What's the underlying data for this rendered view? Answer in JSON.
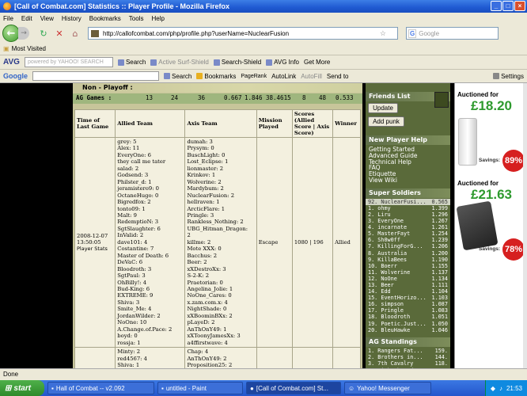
{
  "window": {
    "title": "[Call of Combat.com] Statistics :: Player Profile - Mozilla Firefox"
  },
  "menu": [
    "File",
    "Edit",
    "View",
    "History",
    "Bookmarks",
    "Tools",
    "Help"
  ],
  "nav": {
    "url": "http://callofcombat.com/php/profile.php?userName=NuclearFusion",
    "search_placeholder": "Google"
  },
  "bookmarks": {
    "item": "Most Visited"
  },
  "avgbar": {
    "logo": "AVG",
    "yahoo_placeholder": "powered by YAHOO! SEARCH",
    "search": "Search",
    "active_surf": "Active Surf-Shield",
    "search_shield": "Search-Shield",
    "avg_info": "AVG Info",
    "get_more": "Get More"
  },
  "googlebar": {
    "logo": "Google",
    "search": "Search",
    "bookmarks": "Bookmarks",
    "pagerank": "PageRank",
    "autolink": "AutoLink",
    "autofill": "AutoFill",
    "send_to": "Send to",
    "settings": "Settings"
  },
  "stats": {
    "header": "Non - Playoff :",
    "ag_label": "AG Games :",
    "values": [
      "13",
      "24",
      "36",
      "0.667",
      "1.846",
      "38.4615",
      "8",
      "48",
      "0.533"
    ]
  },
  "table": {
    "headers": [
      "Time of Last Game",
      "Allied Team",
      "Axis Team",
      "Mission Played",
      "Scores (Allied Score | Axis Score)",
      "Winner"
    ],
    "row1": {
      "time": "2008-12-07 13:50:05",
      "player_stats": "Player Stats",
      "mission": "Escape",
      "score": "1080 | 196",
      "winner": "Allied",
      "allied": [
        "grey: 5",
        "Alex: 11",
        "EveryOne: 6",
        "they call me tater",
        "salad: 2",
        "Godsend: 3",
        "Philster_d: 1",
        "jeramistero9: 0",
        "OctaneHugo: 0",
        "Bigredfox: 2",
        "tonto09: 1",
        "Malt: 9",
        "RedemptioN: 3",
        "SgtSlaughter: 6",
        "InValid: 2",
        "dave101: 4",
        "Costantine: 7",
        "Master of Death: 6",
        "DeVaC: 6",
        "Bloodroth: 3",
        "SgtPaul: 3",
        "OhBilly!: 4",
        "Bud-King: 6",
        "EXTREME: 9",
        "Shiva: 3",
        "Smite_Me: 4",
        "JordanWilder: 2",
        "NoOne: 10",
        "A.Change.of.Pace: 2",
        "boyd: 0",
        "rossja: 1"
      ],
      "axis": [
        "dumah: 3",
        "Prysym: 0",
        "BuschLight: 0",
        "Lost_Eclipse: 1",
        "lionmaster: 2",
        "Krinkov: 1",
        "Wolverine: 2",
        "Mardybum: 2",
        "NuclearFusion: 2",
        "hellraven: 1",
        "ArcticFlare: 1",
        "Pringle: 3",
        "Rankless_Nothing: 2",
        "UBG_Hitman_Dragon:",
        "2",
        "killme: 2",
        "Mote XXX: 0",
        "Bacchus: 2",
        "Beer: 2",
        "xXDestroXx: 3",
        "S-2-K: 2",
        "Praetorian: 0",
        "Angelina_Jolie: 1",
        "NoOne_Cares: 0",
        "x.zam.com.x: 4",
        "NightShade: 0",
        "xXBoominBXx: 2",
        "pLayeD: 2",
        "AnThOnY49: 1",
        "xXToonyJamesXx: 3",
        "a4ffirstwave: 4"
      ]
    },
    "row2": {
      "allied": [
        "Minty: 2",
        "red4567: 4",
        "Shiva: 1",
        "kell: 0"
      ],
      "axis": [
        "Chap: 4",
        "AnThOnY49: 2",
        "Proposition25: 2",
        "x.zam.com.x: 2"
      ]
    }
  },
  "sidebar": {
    "friends_title": "Friends List",
    "update_btn": "Update",
    "add_punk_btn": "Add punk",
    "help_title": "New Player Help",
    "help_links": [
      "Getting Started",
      "Advanced Guide",
      "Technical Help",
      "FAQ",
      "Etiquette",
      "View Wiki"
    ],
    "soldiers_title": "Super Soldiers",
    "soldiers": [
      [
        "92. NuclearFusi...",
        "0.565"
      ],
      [
        "1. ohmy",
        "1.399"
      ],
      [
        "2. Liru",
        "1.296"
      ],
      [
        "3. EveryOne",
        "1.267"
      ],
      [
        "4. incarnate",
        "1.261"
      ],
      [
        "5. MasterFayt",
        "1.254"
      ],
      [
        "6. Sh0w0ff",
        "1.239"
      ],
      [
        "7. KillingForG...",
        "1.206"
      ],
      [
        "8. Australia",
        "1.200"
      ],
      [
        "9. KillaBees",
        "1.190"
      ],
      [
        "10. Boerr",
        "1.155"
      ],
      [
        "11. Wolverine",
        "1.137"
      ],
      [
        "12. NoOne",
        "1.134"
      ],
      [
        "13. Beer",
        "1.111"
      ],
      [
        "14. Edd",
        "1.104"
      ],
      [
        "15. EventHorizo...",
        "1.103"
      ],
      [
        "16. simpson",
        "1.087"
      ],
      [
        "17. Pringle",
        "1.083"
      ],
      [
        "18. Bloodroth",
        "1.051"
      ],
      [
        "19. Poetic.Just...",
        "1.050"
      ],
      [
        "20. BleuHawke",
        "1.046"
      ]
    ],
    "standings_title": "AG Standings",
    "standings": [
      [
        "1. Rangers Fat...",
        "159."
      ],
      [
        "2. Brothers in...",
        "144."
      ],
      [
        "3. 7th Cavalry",
        "118."
      ],
      [
        "4. NightShroud",
        "113."
      ],
      [
        "5. D-Day Army",
        "60."
      ]
    ]
  },
  "ads": [
    {
      "label": "Auctioned for",
      "price": "£18.20",
      "savings_label": "Savings:",
      "savings": "89%"
    },
    {
      "label": "Auctioned for",
      "price": "£21.63",
      "savings_label": "Savings:",
      "savings": "78%"
    }
  ],
  "status": {
    "text": "Done"
  },
  "taskbar": {
    "start": "start",
    "tasks": [
      "Hall of Combat -- v2.092",
      "untitled - Paint",
      "[Call of Combat.com] St...",
      "Yahoo! Messenger"
    ],
    "time": "21:53"
  },
  "colors": {
    "page_bg": "#000000",
    "content_bg": "#c7c59a",
    "stats_green": "#9fb67e",
    "sidebar": "#5a6a3a",
    "price_green": "#2e9a2e",
    "savings_red": "#d62020"
  }
}
